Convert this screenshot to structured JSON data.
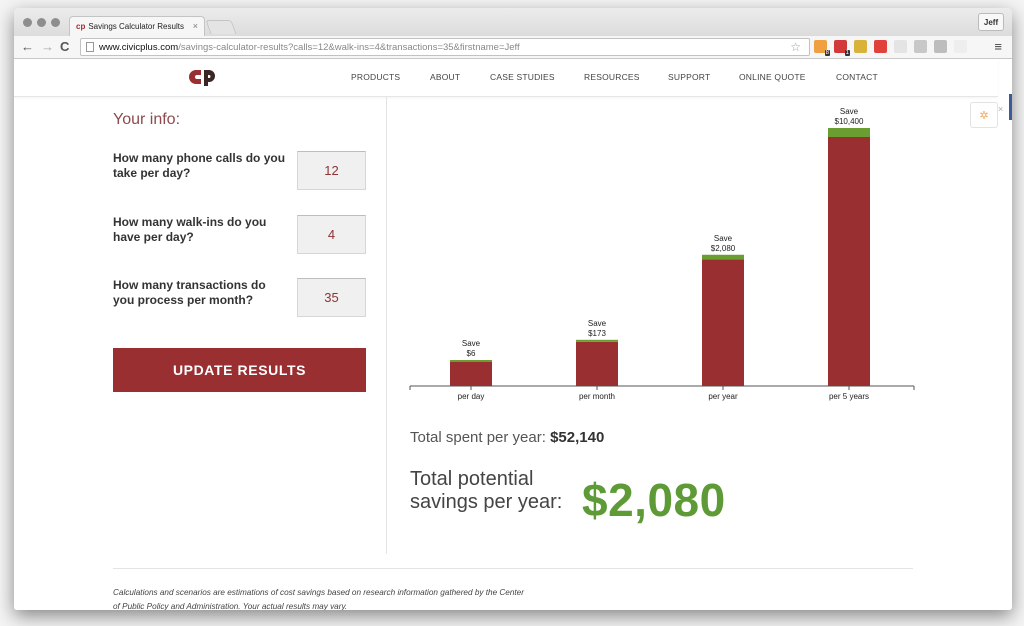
{
  "browser": {
    "tab_title": "Savings Calculator Results",
    "tab_favicon": "cp",
    "url_domain": "www.civicplus.com",
    "url_path": "/savings-calculator-results?calls=12&walk-ins=4&transactions=35&firstname=Jeff",
    "profile_name": "Jeff",
    "extensions": [
      {
        "name": "hubspot-extension",
        "badge": "8",
        "color": "#f0a040"
      },
      {
        "name": "adblock-extension",
        "badge": "1",
        "color": "#d23a3a"
      },
      {
        "name": "chat-extension",
        "badge": "",
        "color": "#d9b23a"
      },
      {
        "name": "opera-extension",
        "badge": "",
        "color": "#e0413a"
      },
      {
        "name": "cloud-extension",
        "badge": "",
        "color": "#e4e4e4"
      },
      {
        "name": "grammarly-extension",
        "badge": "",
        "color": "#c8c8c8"
      },
      {
        "name": "note-extension",
        "badge": "",
        "color": "#bdbdbd"
      },
      {
        "name": "filter-extension",
        "badge": "",
        "color": "#eeeeee"
      }
    ]
  },
  "nav": {
    "logo": "cp",
    "items": [
      "PRODUCTS",
      "ABOUT",
      "CASE STUDIES",
      "RESOURCES",
      "SUPPORT",
      "ONLINE QUOTE",
      "CONTACT"
    ]
  },
  "form": {
    "heading": "Your info:",
    "questions": [
      {
        "label": "How many phone calls do you take per day?",
        "value": "12"
      },
      {
        "label": "How many walk-ins do you have per day?",
        "value": "4"
      },
      {
        "label": "How many transactions do you process per month?",
        "value": "35"
      }
    ],
    "submit_label": "UPDATE RESULTS"
  },
  "chart_data": {
    "type": "bar",
    "stacked": true,
    "categories": [
      "per day",
      "per month",
      "per year",
      "per 5 years"
    ],
    "series": [
      {
        "name": "Cost",
        "color": "#9a2f32"
      },
      {
        "name": "Savings",
        "color": "#6a9e30",
        "values": [
          6,
          173,
          2080,
          10400
        ]
      }
    ],
    "data_labels": [
      "Save\n$6",
      "Save\n$173",
      "Save\n$2,080",
      "Save\n$10,400"
    ],
    "label_prefix": "Save",
    "value_labels": [
      "$6",
      "$173",
      "$2,080",
      "$10,400"
    ],
    "title": "",
    "xlabel": "",
    "ylabel": "",
    "grid": false,
    "legend": "none"
  },
  "results": {
    "total_spent_label": "Total spent per year:",
    "total_spent_value": "$52,140",
    "savings_label": "Total potential savings per year:",
    "savings_value": "$2,080"
  },
  "disclaimer": "Calculations and scenarios are estimations of cost savings based on research information gathered by the Center of Public Policy and Administration. Your actual results may vary.",
  "colors": {
    "brand_red": "#9a2f32",
    "savings_green": "#5e9b37"
  }
}
